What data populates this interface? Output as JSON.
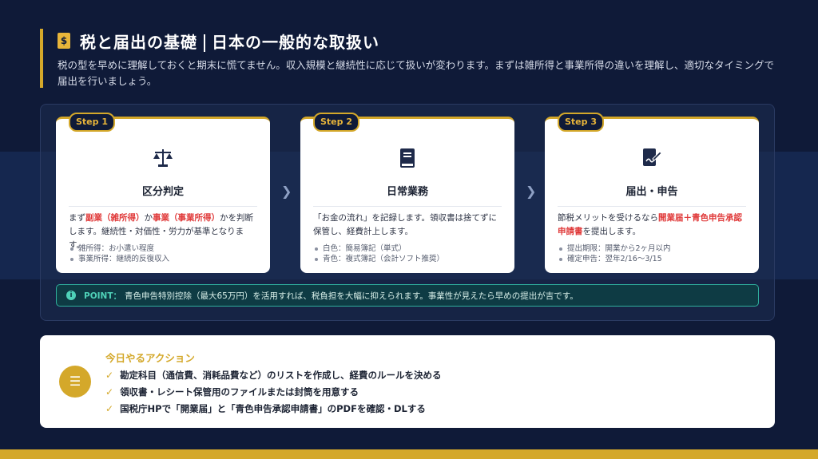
{
  "header": {
    "title_left": "税と届出の基礎",
    "title_right": "日本の一般的な取扱い",
    "lead": "税の型を早めに理解しておくと期末に慌てません。収入規模と継続性に応じて扱いが変わります。まずは雑所得と事業所得の違いを理解し、適切なタイミングで届出を行いましょう。"
  },
  "steps": [
    {
      "badge": "Step 1",
      "icon": "scale-icon",
      "title": "区分判定",
      "desc_parts": [
        "まず",
        "副業（雑所得）",
        "か",
        "事業（事業所得）",
        "かを判断します。継続性・対価性・労力が基準となります。"
      ],
      "bullets": [
        "雑所得：お小遣い程度",
        "事業所得：継続的反復収入"
      ]
    },
    {
      "badge": "Step 2",
      "icon": "book-icon",
      "title": "日常業務",
      "desc": "「お金の流れ」を記録します。領収書は捨てずに保管し、経費計上します。",
      "bullets": [
        "白色：簡易簿記（単式）",
        "青色：複式簿記（会計ソフト推奨）"
      ]
    },
    {
      "badge": "Step 3",
      "icon": "signature-icon",
      "title": "届出・申告",
      "desc_parts": [
        "節税メリットを受けるなら",
        "開業届＋青色申告承認申請書",
        "を提出します。"
      ],
      "bullets": [
        "提出期限：開業から2ヶ月以内",
        "確定申告：翌年2/16〜3/15"
      ]
    }
  ],
  "point": {
    "label": "POINT：",
    "text": "青色申告特別控除（最大65万円）を活用すれば、税負担を大幅に抑えられます。事業性が見えたら早めの提出が吉です。"
  },
  "action": {
    "title": "今日やるアクション",
    "items": [
      "勘定科目（通信費、消耗品費など）のリストを作成し、経費のルールを決める",
      "領収書・レシート保管用のファイルまたは封筒を用意する",
      "国税庁HPで「開業届」と「青色申告承認申請書」のPDFを確認・DLする"
    ]
  },
  "colors": {
    "background": "#0f1a38",
    "accent_gold": "#d4a82a",
    "highlight_red": "#e03a3a",
    "point_teal": "#4fd1b8"
  }
}
